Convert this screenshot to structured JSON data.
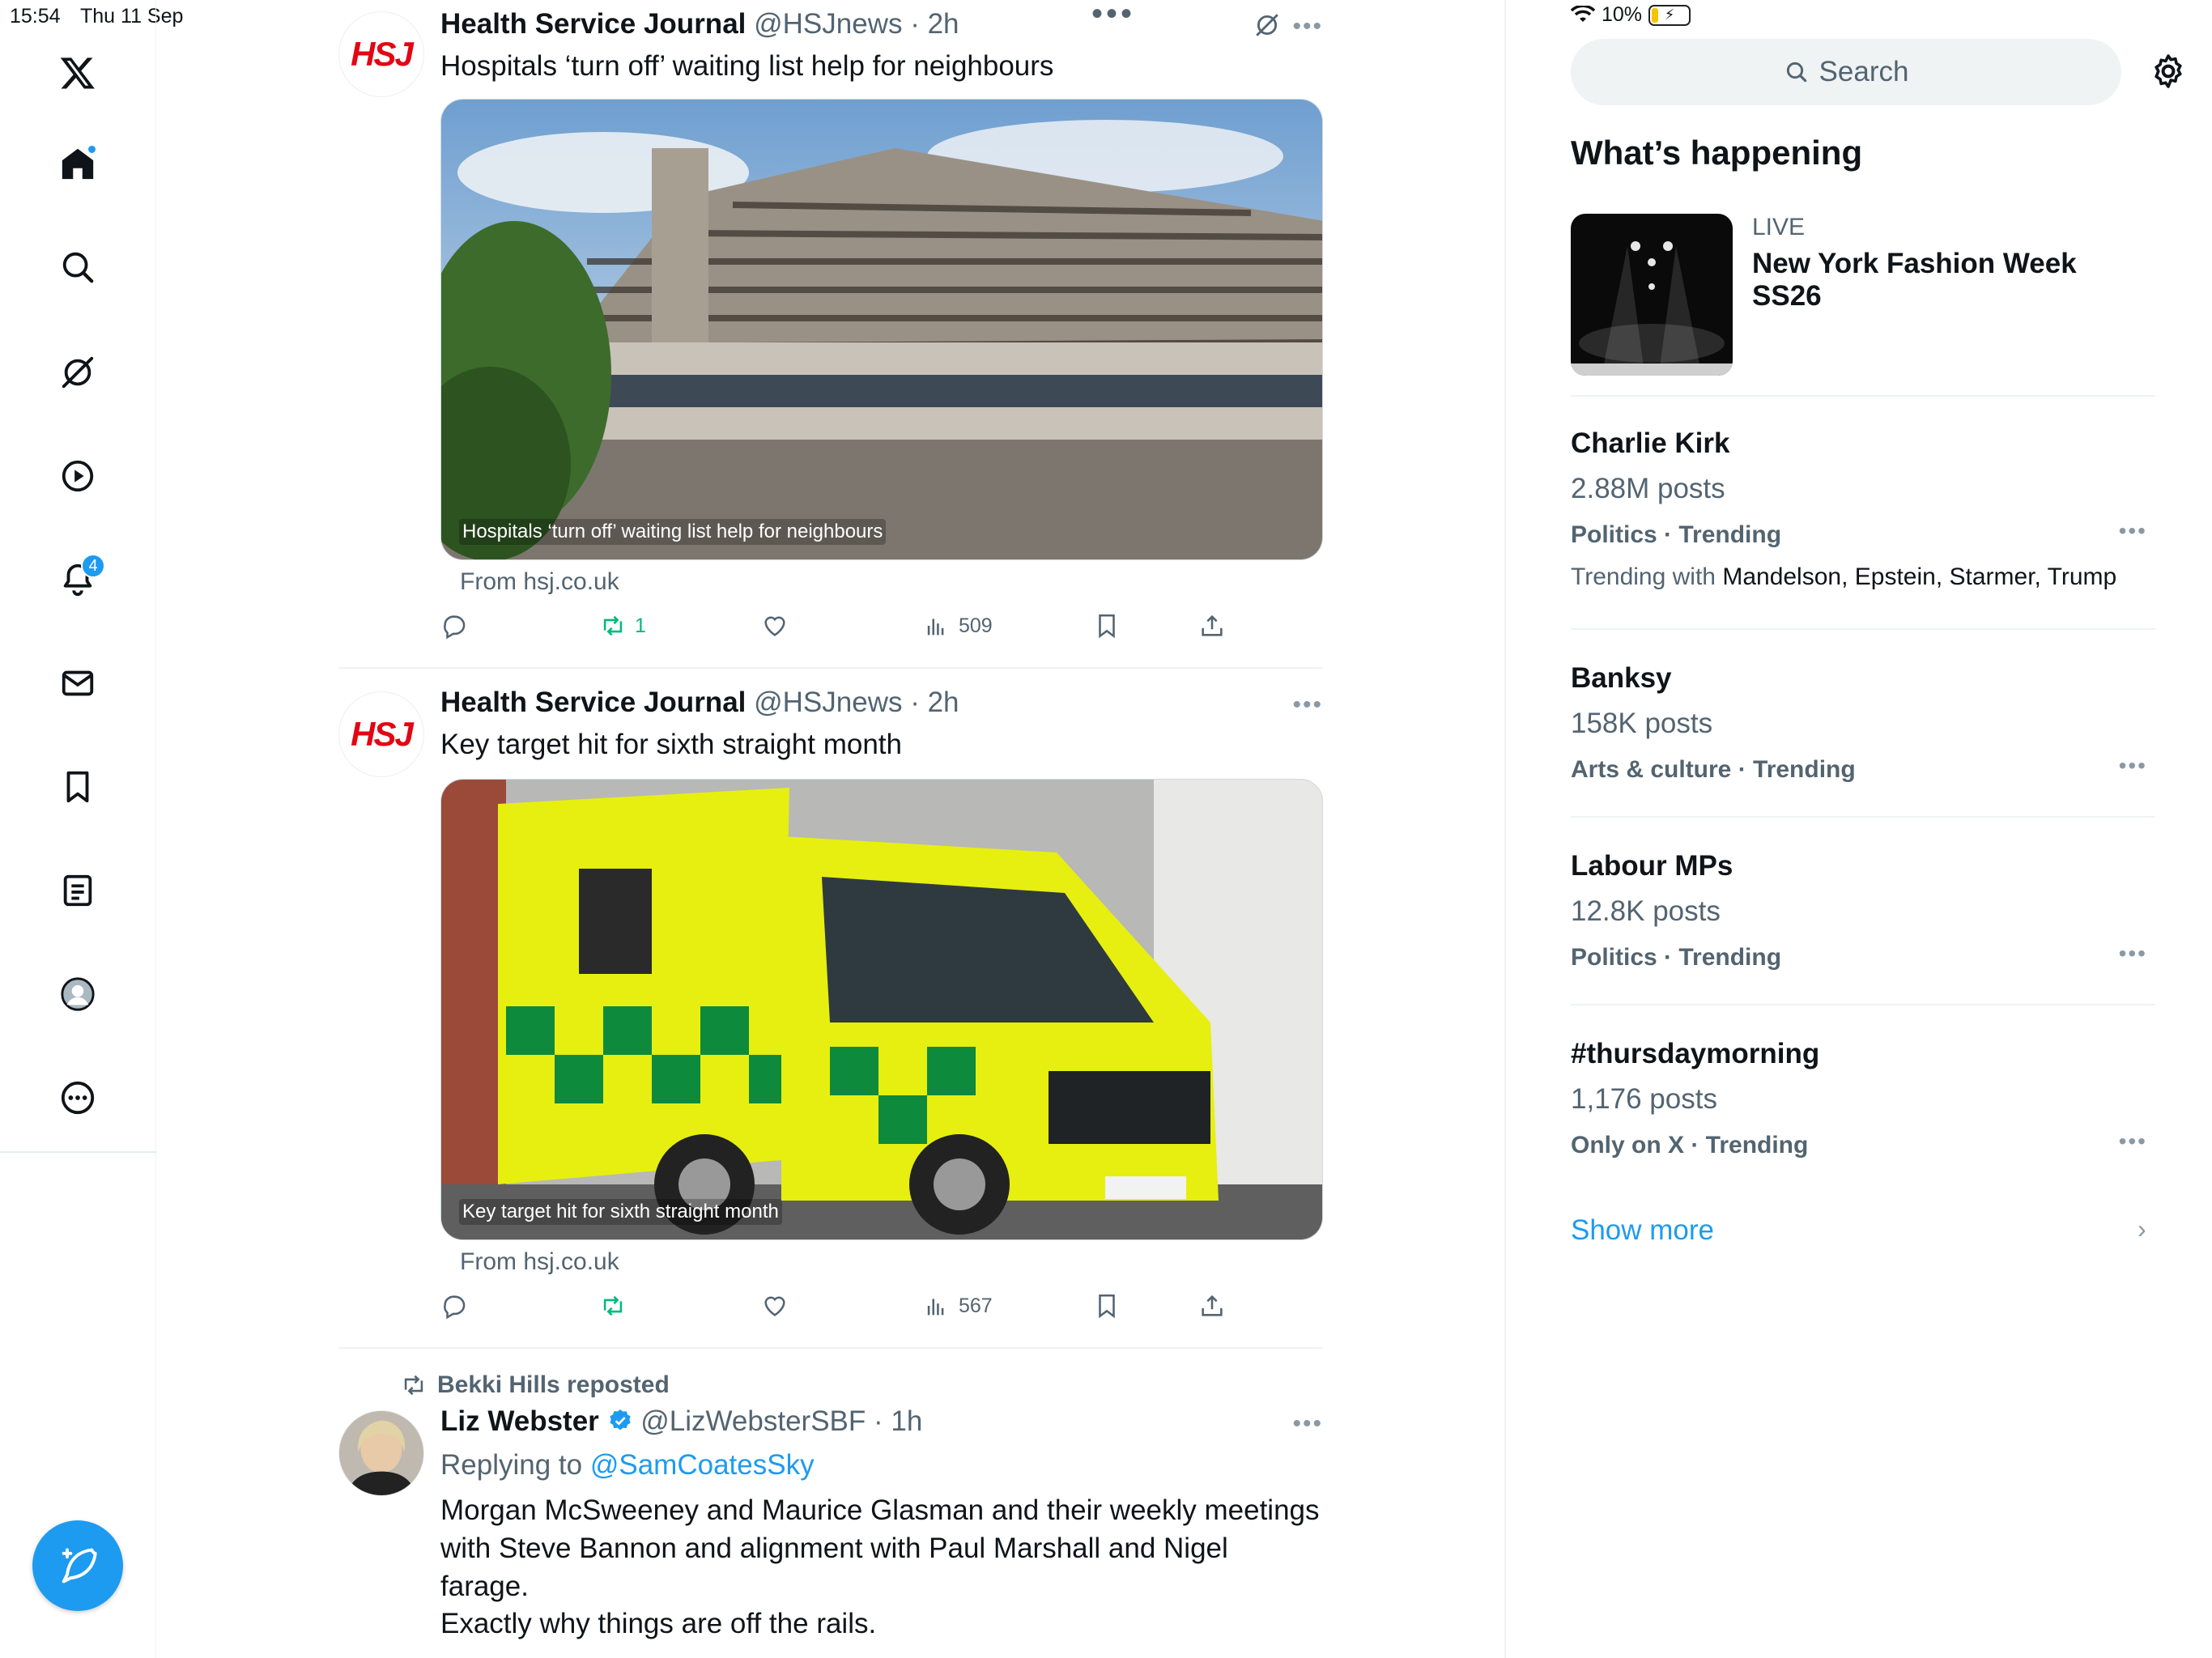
{
  "status": {
    "time": "15:54",
    "date": "Thu 11 Sep",
    "battery": "10%"
  },
  "nav": {
    "notifications_badge": "4"
  },
  "tweets": [
    {
      "name": "Health Service Journal",
      "handle": "@HSJnews",
      "time": "2h",
      "text": "Hospitals ‘turn off’ waiting list help for neighbours",
      "caption": "Hospitals ‘turn off’ waiting list help for neighbours",
      "from": "From hsj.co.uk",
      "retweets": "1",
      "views": "509"
    },
    {
      "name": "Health Service Journal",
      "handle": "@HSJnews",
      "time": "2h",
      "text": "Key target hit for sixth straight month",
      "caption": "Key target hit for sixth straight month",
      "from": "From hsj.co.uk",
      "retweets": "",
      "views": "567"
    }
  ],
  "repost": {
    "by": "Bekki Hills reposted",
    "name": "Liz Webster",
    "handle": "@LizWebsterSBF",
    "time": "1h",
    "replying_prefix": "Replying to",
    "replying_to": "@SamCoatesSky",
    "line1": "Morgan McSweeney and Maurice Glasman and their weekly meetings",
    "line2": "with Steve Bannon and alignment with Paul Marshall and Nigel farage.",
    "line3": "Exactly why things are off the rails."
  },
  "sidebar": {
    "search_placeholder": "Search",
    "heading": "What’s happening",
    "live_label": "LIVE",
    "live_title": "New York Fashion Week SS26",
    "trends": [
      {
        "title": "Charlie Kirk",
        "posts": "2.88M posts",
        "category": "Politics · Trending",
        "with_prefix": "Trending with",
        "with": "Mandelson, Epstein, Starmer, Trump"
      },
      {
        "title": "Banksy",
        "posts": "158K posts",
        "category": "Arts & culture · Trending"
      },
      {
        "title": "Labour MPs",
        "posts": "12.8K posts",
        "category": "Politics · Trending"
      },
      {
        "title": "#thursdaymorning",
        "posts": "1,176 posts",
        "category": "Only on X · Trending"
      }
    ],
    "show_more": "Show more"
  },
  "colors": {
    "accent": "#1d9bf0",
    "retweet_green": "#00ba7c",
    "muted": "#536471",
    "hsj_red": "#e30613"
  }
}
